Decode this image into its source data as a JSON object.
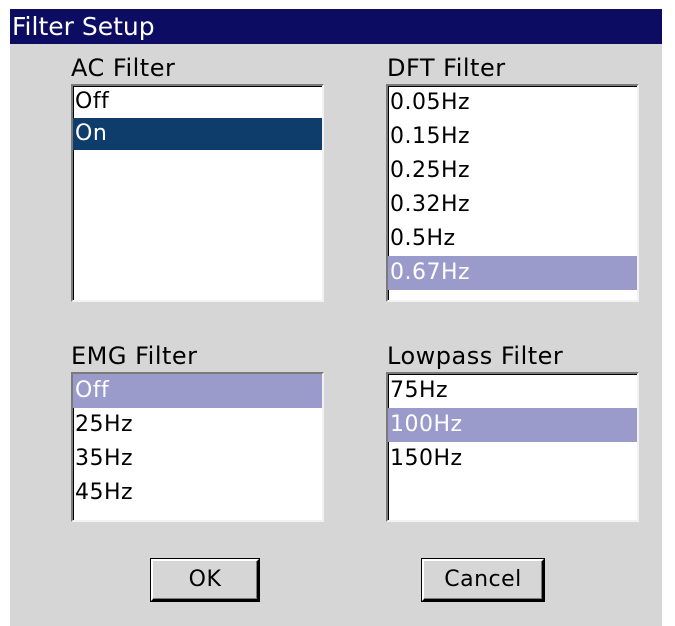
{
  "window": {
    "title": "Filter Setup"
  },
  "ac_filter": {
    "label": "AC Filter",
    "items": [
      "Off",
      "On"
    ],
    "selected": "On"
  },
  "dft_filter": {
    "label": "DFT Filter",
    "items": [
      "0.05Hz",
      "0.15Hz",
      "0.25Hz",
      "0.32Hz",
      "0.5Hz",
      "0.67Hz"
    ],
    "selected": "0.67Hz"
  },
  "emg_filter": {
    "label": "EMG Filter",
    "items": [
      "Off",
      "25Hz",
      "35Hz",
      "45Hz"
    ],
    "selected": "Off"
  },
  "lowpass_filter": {
    "label": "Lowpass Filter",
    "items": [
      "75Hz",
      "100Hz",
      "150Hz"
    ],
    "selected": "100Hz"
  },
  "buttons": {
    "ok_label": "OK",
    "cancel_label": "Cancel"
  },
  "colors": {
    "titlebar": "#0d0c63",
    "dialog_background": "#d6d6d6",
    "focused_selection": "#0f3d6b",
    "inactive_selection": "#9b9bcb"
  }
}
